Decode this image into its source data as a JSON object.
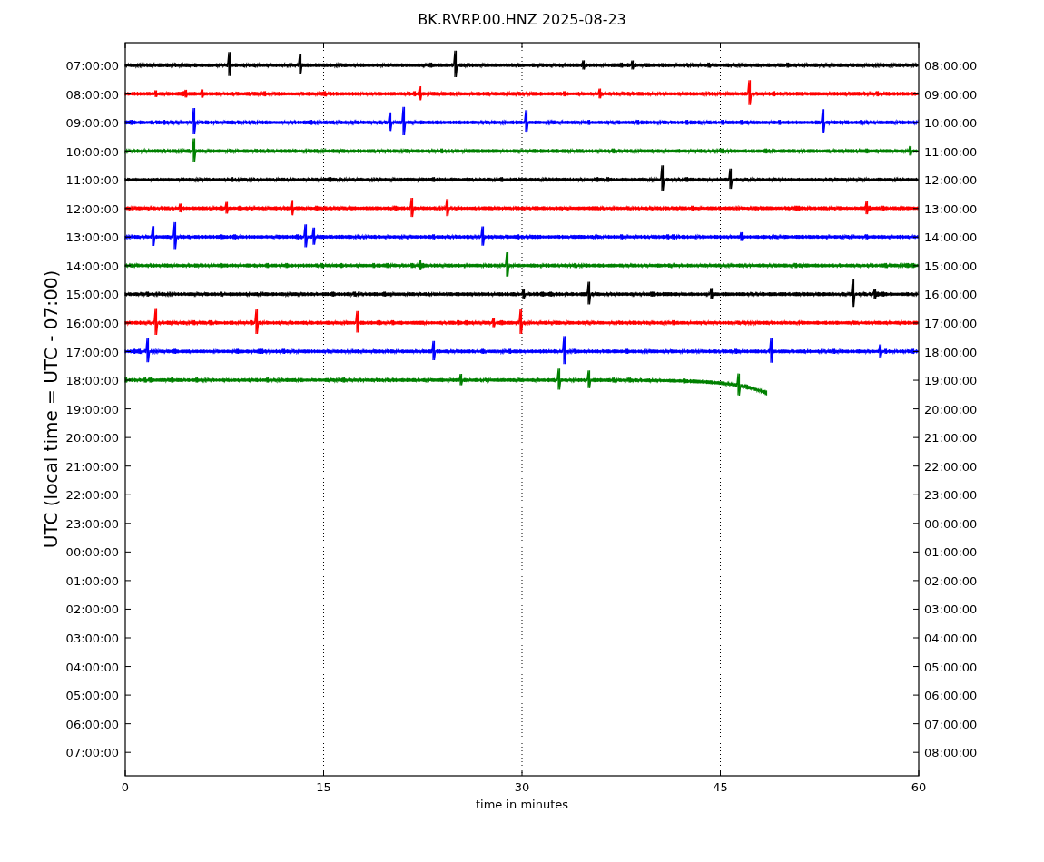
{
  "title": "BK.RVRP.00.HNZ 2025-08-23",
  "ylabel": "UTC (local time = UTC - 07:00)",
  "xlabel": "time in minutes",
  "xticks": [
    "0",
    "15",
    "30",
    "45",
    "60"
  ],
  "left_labels": [
    "07:00:00",
    "08:00:00",
    "09:00:00",
    "10:00:00",
    "11:00:00",
    "12:00:00",
    "13:00:00",
    "14:00:00",
    "15:00:00",
    "16:00:00",
    "17:00:00",
    "18:00:00",
    "19:00:00",
    "20:00:00",
    "21:00:00",
    "22:00:00",
    "23:00:00",
    "00:00:00",
    "01:00:00",
    "02:00:00",
    "03:00:00",
    "04:00:00",
    "05:00:00",
    "06:00:00",
    "07:00:00"
  ],
  "right_labels": [
    "08:00:00",
    "09:00:00",
    "10:00:00",
    "11:00:00",
    "12:00:00",
    "13:00:00",
    "14:00:00",
    "15:00:00",
    "16:00:00",
    "17:00:00",
    "18:00:00",
    "19:00:00",
    "20:00:00",
    "21:00:00",
    "22:00:00",
    "23:00:00",
    "00:00:00",
    "01:00:00",
    "02:00:00",
    "03:00:00",
    "04:00:00",
    "05:00:00",
    "06:00:00",
    "07:00:00",
    "08:00:00"
  ],
  "traces": [
    {
      "color": "#000000",
      "kind": "complete"
    },
    {
      "color": "#ff0000",
      "kind": "complete"
    },
    {
      "color": "#0000ff",
      "kind": "complete"
    },
    {
      "color": "#008000",
      "kind": "complete"
    },
    {
      "color": "#000000",
      "kind": "complete"
    },
    {
      "color": "#ff0000",
      "kind": "complete"
    },
    {
      "color": "#0000ff",
      "kind": "complete"
    },
    {
      "color": "#008000",
      "kind": "complete"
    },
    {
      "color": "#000000",
      "kind": "complete"
    },
    {
      "color": "#ff0000",
      "kind": "complete"
    },
    {
      "color": "#0000ff",
      "kind": "complete"
    },
    {
      "color": "#008000",
      "kind": "partial"
    }
  ]
}
